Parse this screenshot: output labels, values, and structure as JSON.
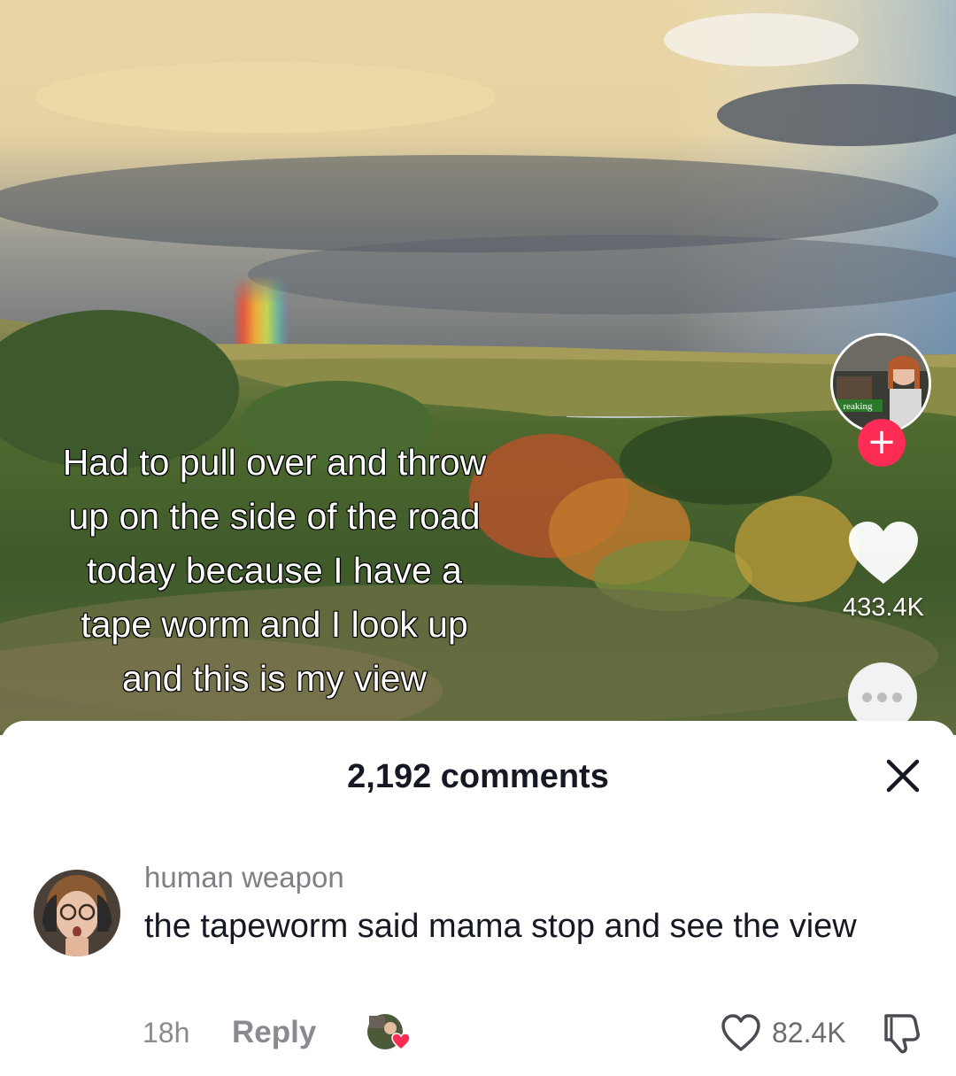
{
  "video": {
    "caption_lines": [
      "Had to pull over and throw",
      "up on the side of the road",
      "today because I have a",
      "tape worm and I look up",
      "and this is my view"
    ],
    "creator_avatar_text": "reaking",
    "follow_symbol": "+",
    "like_count": "433.4K",
    "icons": {
      "like": "heart-icon",
      "more": "ellipsis-icon",
      "follow": "plus-icon"
    },
    "colors": {
      "follow": "#fe2c55"
    }
  },
  "comments_panel": {
    "title": "2,192 comments",
    "close_icon": "close-icon",
    "comments": [
      {
        "username": "human weapon",
        "text": "the tapeworm said mama stop and see the view",
        "time": "18h",
        "reply_label": "Reply",
        "like_count": "82.4K",
        "creator_liked": true
      }
    ]
  }
}
